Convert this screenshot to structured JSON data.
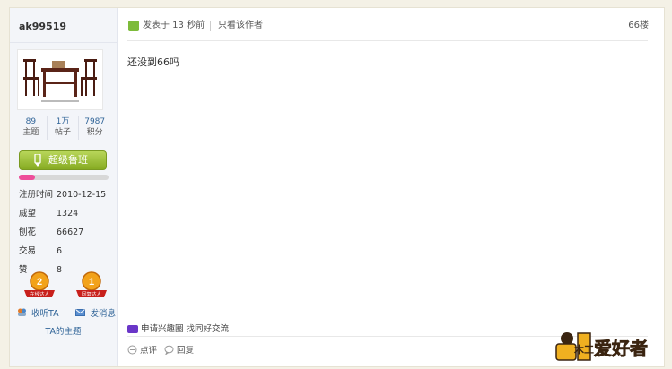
{
  "user": {
    "name": "ak99519",
    "stats": [
      {
        "value": "89",
        "label": "主题"
      },
      {
        "value": "1万",
        "label": "帖子"
      },
      {
        "value": "7987",
        "label": "积分"
      }
    ],
    "rank": "超级鲁班",
    "rank_progress": 0.18,
    "info": [
      {
        "key": "注册时间",
        "value": "2010-12-15"
      },
      {
        "key": "威望",
        "value": "1324"
      },
      {
        "key": "刨花",
        "value": "66627"
      },
      {
        "key": "交易",
        "value": "6"
      },
      {
        "key": "赞",
        "value": "8"
      }
    ],
    "medals": [
      {
        "number": "2",
        "caption": "在线达人"
      },
      {
        "number": "1",
        "caption": "回复达人"
      }
    ],
    "follow_label": "收听TA",
    "message_label": "发消息",
    "topics_link": "TA的主题"
  },
  "post": {
    "time_text": "发表于 13 秒前",
    "only_author": "只看该作者",
    "floor": "66楼",
    "content": "还没到66吗",
    "interest_text": "申请兴趣圈 找同好交流",
    "like_label": "点评",
    "reply_label": "回复"
  },
  "logo": {
    "text": "爱好者",
    "prefix": "木工"
  },
  "colors": {
    "accent": "#7dbb3a",
    "link": "#336699",
    "progress": "#ee4d9a",
    "logo": "#e8471a"
  }
}
